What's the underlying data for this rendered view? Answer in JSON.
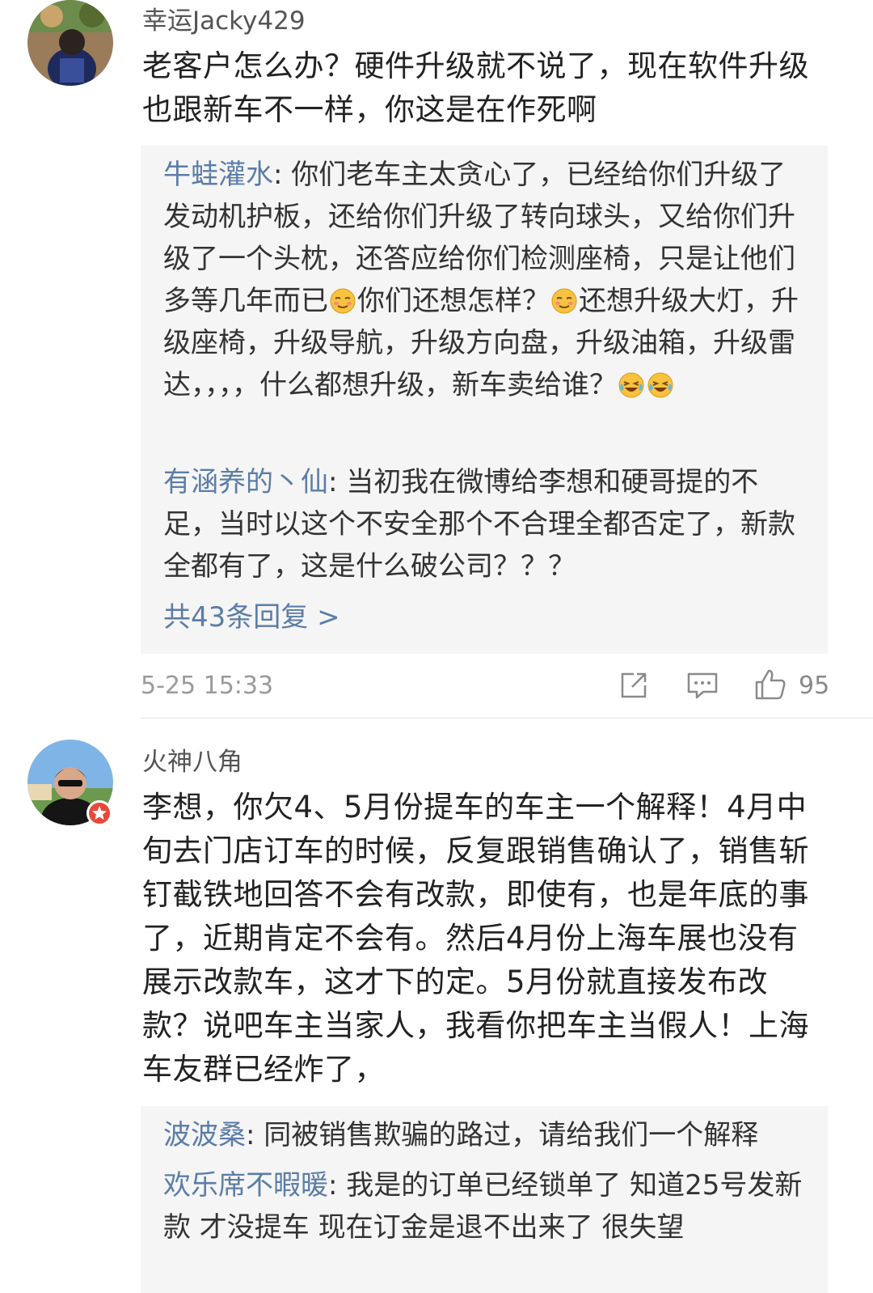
{
  "comments": [
    {
      "username": "幸运Jacky429",
      "text": "老客户怎么办？硬件升级就不说了，现在软件升级也跟新车不一样，你这是在作死啊",
      "replies": [
        {
          "author": "牛蛙灌水",
          "sep": ": ",
          "text_parts": [
            "你们老车主太贪心了，已经给你们升级了发动机护板，还给你们升级了转向球头，又给你们升级了一个头枕，还答应给你们检测座椅，只是让他们多等几年而已",
            "你们还想怎样？",
            "还想升级大灯，升级座椅，升级导航，升级方向盘，升级油箱，升级雷达，，，，什么都想升级，新车卖给谁？"
          ],
          "emojis": [
            "smirk-emoji",
            "smirk-emoji",
            "laugh-cry-emoji",
            "laugh-cry-emoji"
          ]
        },
        {
          "author": "有涵养的丶仙",
          "sep": ": ",
          "text": "当初我在微博给李想和硬哥提的不足，当时以这个不安全那个不合理全都否定了，新款全都有了，这是什么破公司？？？"
        }
      ],
      "more_replies": "共43条回复 >",
      "time": "5-25 15:33",
      "like_count": "95",
      "icons": {
        "share": "share-icon",
        "comment": "comment-icon",
        "like": "thumbs-up-icon"
      }
    },
    {
      "username": "火神八角",
      "text": "李想，你欠4、5月份提车的车主一个解释！4月中旬去门店订车的时候，反复跟销售确认了，销售斩钉截铁地回答不会有改款，即使有，也是年底的事了，近期肯定不会有。然后4月份上海车展也没有展示改款车，这才下的定。5月份就直接发布改款？说吧车主当家人，我看你把车主当假人！上海车友群已经炸了，",
      "replies": [
        {
          "author": "波波桑",
          "sep": ": ",
          "text": "同被销售欺骗的路过，请给我们一个解释"
        },
        {
          "author": "欢乐席不暇暖",
          "sep": ": ",
          "text": "我是的订单已经锁单了 知道25号发新款 才没提车 现在订金是退不出来了 很失望"
        }
      ]
    }
  ],
  "colors": {
    "reply_author": "#5b7da7",
    "reply_bg": "#f5f5f5",
    "meta": "#9a9a9a",
    "vip_badge": "#e8473a"
  }
}
